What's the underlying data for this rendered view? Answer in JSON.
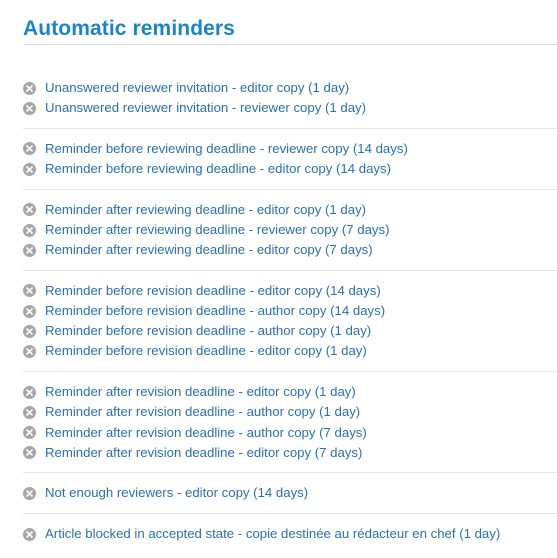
{
  "page": {
    "title": "Automatic reminders"
  },
  "groups": [
    {
      "items": [
        {
          "label": "Unanswered reviewer invitation - editor copy (1 day)"
        },
        {
          "label": "Unanswered reviewer invitation - reviewer copy (1 day)"
        }
      ]
    },
    {
      "items": [
        {
          "label": "Reminder before reviewing deadline - reviewer copy (14 days)"
        },
        {
          "label": "Reminder before reviewing deadline - editor copy (14 days)"
        }
      ]
    },
    {
      "items": [
        {
          "label": "Reminder after reviewing deadline - editor copy (1 day)"
        },
        {
          "label": "Reminder after reviewing deadline - reviewer copy (7 days)"
        },
        {
          "label": "Reminder after reviewing deadline - editor copy (7 days)"
        }
      ]
    },
    {
      "items": [
        {
          "label": "Reminder before revision deadline - editor copy (14 days)"
        },
        {
          "label": "Reminder before revision deadline - author copy (14 days)"
        },
        {
          "label": "Reminder before revision deadline - author copy (1 day)"
        },
        {
          "label": "Reminder before revision deadline - editor copy (1 day)"
        }
      ]
    },
    {
      "items": [
        {
          "label": "Reminder after revision deadline - editor copy (1 day)"
        },
        {
          "label": "Reminder after revision deadline - author copy (1 day)"
        },
        {
          "label": "Reminder after revision deadline - author copy (7 days)"
        },
        {
          "label": "Reminder after revision deadline - editor copy (7 days)"
        }
      ]
    },
    {
      "items": [
        {
          "label": "Not enough reviewers - editor copy (14 days)"
        }
      ]
    },
    {
      "items": [
        {
          "label": "Article blocked in accepted state - copie destinée au rédacteur en chef (1 day)"
        }
      ]
    }
  ],
  "icons": {
    "remove": "remove-circle-icon"
  },
  "colors": {
    "title": "#1a84c7",
    "link": "#2a6fb0",
    "icon": "#a6a6a6",
    "divider": "#e4e7e9"
  }
}
